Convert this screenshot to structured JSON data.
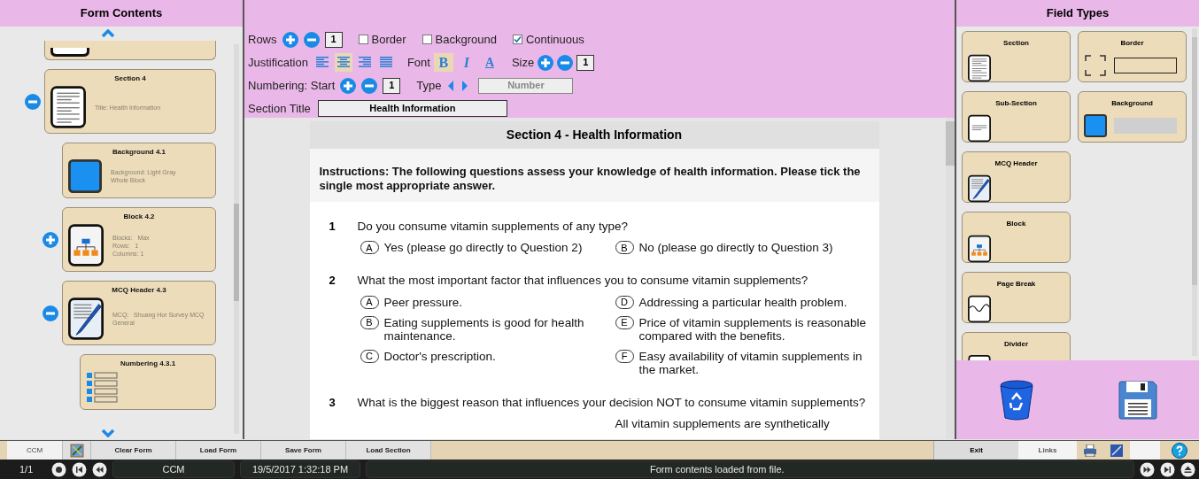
{
  "left_panel": {
    "title": "Form Contents",
    "items": [
      {
        "kind": "document",
        "title": "Section 4",
        "details": [
          "Title: Health Information"
        ],
        "expanded": true,
        "children": [
          {
            "kind": "background",
            "title": "Background 4.1",
            "details": [
              "Background: Light Gray",
              "Whole Block"
            ]
          },
          {
            "kind": "block",
            "title": "Block 4.2",
            "details": [
              "Blocks:   Max",
              "Rows:   1",
              "Columns: 1"
            ],
            "expanded": false
          },
          {
            "kind": "mcq",
            "title": "MCQ Header 4.3",
            "details": [
              "MCQ:   Shuang Hor Survey MCQ",
              "General"
            ],
            "expanded": true,
            "children": [
              {
                "kind": "numbering",
                "title": "Numbering 4.3.1"
              }
            ]
          }
        ]
      }
    ]
  },
  "toolbar": {
    "rows": {
      "label": "Rows",
      "value": "1"
    },
    "checkboxes": [
      {
        "label": "Border",
        "checked": false
      },
      {
        "label": "Background",
        "checked": false
      },
      {
        "label": "Continuous",
        "checked": true
      }
    ],
    "justification": {
      "label": "Justification",
      "options": [
        {
          "kind": "left",
          "selected": false
        },
        {
          "kind": "center",
          "selected": true
        },
        {
          "kind": "right",
          "selected": false
        },
        {
          "kind": "full",
          "selected": false
        }
      ]
    },
    "font": {
      "label": "Font",
      "styles": [
        {
          "kind": "bold",
          "glyph": "B",
          "selected": true
        },
        {
          "kind": "italic",
          "glyph": "I",
          "selected": false
        },
        {
          "kind": "color",
          "glyph": "A",
          "selected": false
        }
      ]
    },
    "size": {
      "label": "Size",
      "value": "1"
    },
    "numbering": {
      "label": "Numbering: Start",
      "value": "1",
      "type_label": "Type",
      "type_value": "Number"
    },
    "section_title": {
      "label": "Section Title",
      "value": "Health Information"
    }
  },
  "document": {
    "header": "Section 4 - Health Information",
    "instructions": "Instructions: The following questions assess your knowledge of health information. Please tick the single most appropriate answer.",
    "questions": [
      {
        "number": "1",
        "text": "Do you consume vitamin supplements of any type?",
        "options": [
          {
            "letter": "A",
            "text": "Yes (please go directly to Question 2)"
          },
          {
            "letter": "B",
            "text": "No (please go directly to Question 3)"
          }
        ]
      },
      {
        "number": "2",
        "text": "What the most important factor that influences you to consume vitamin supplements?",
        "options": [
          {
            "letter": "A",
            "text": "Peer pressure."
          },
          {
            "letter": "D",
            "text": "Addressing a particular health problem."
          },
          {
            "letter": "B",
            "text": "Eating supplements is good for health maintenance."
          },
          {
            "letter": "E",
            "text": "Price of vitamin supplements is reasonable compared with the benefits."
          },
          {
            "letter": "C",
            "text": "Doctor's prescription."
          },
          {
            "letter": "F",
            "text": "Easy availability of vitamin supplements in the market."
          }
        ]
      },
      {
        "number": "3",
        "text": "What is the biggest reason that influences your decision NOT to consume vitamin supplements?",
        "options": [
          {
            "text": "All vitamin supplements are synthetically"
          }
        ]
      }
    ]
  },
  "right_panel": {
    "title": "Field Types",
    "columns": [
      [
        {
          "kind": "document",
          "title": "Section"
        },
        {
          "kind": "subsection",
          "title": "Sub-Section"
        },
        {
          "kind": "mcq",
          "title": "MCQ Header"
        },
        {
          "kind": "block",
          "title": "Block"
        },
        {
          "kind": "pagebreak",
          "title": "Page Break"
        },
        {
          "kind": "divider",
          "title": "Divider"
        }
      ],
      [
        {
          "kind": "border",
          "title": "Border"
        },
        {
          "kind": "background",
          "title": "Background"
        }
      ]
    ]
  },
  "button_bar": {
    "left": [
      "CCM",
      "Clear Form",
      "Load Form",
      "Save Form",
      "Load Section"
    ],
    "right": [
      "Exit",
      "Links"
    ]
  },
  "status_bar": {
    "page": "1/1",
    "app": "CCM",
    "datetime": "19/5/2017 1:32:18 PM",
    "message": "Form contents loaded from file."
  }
}
